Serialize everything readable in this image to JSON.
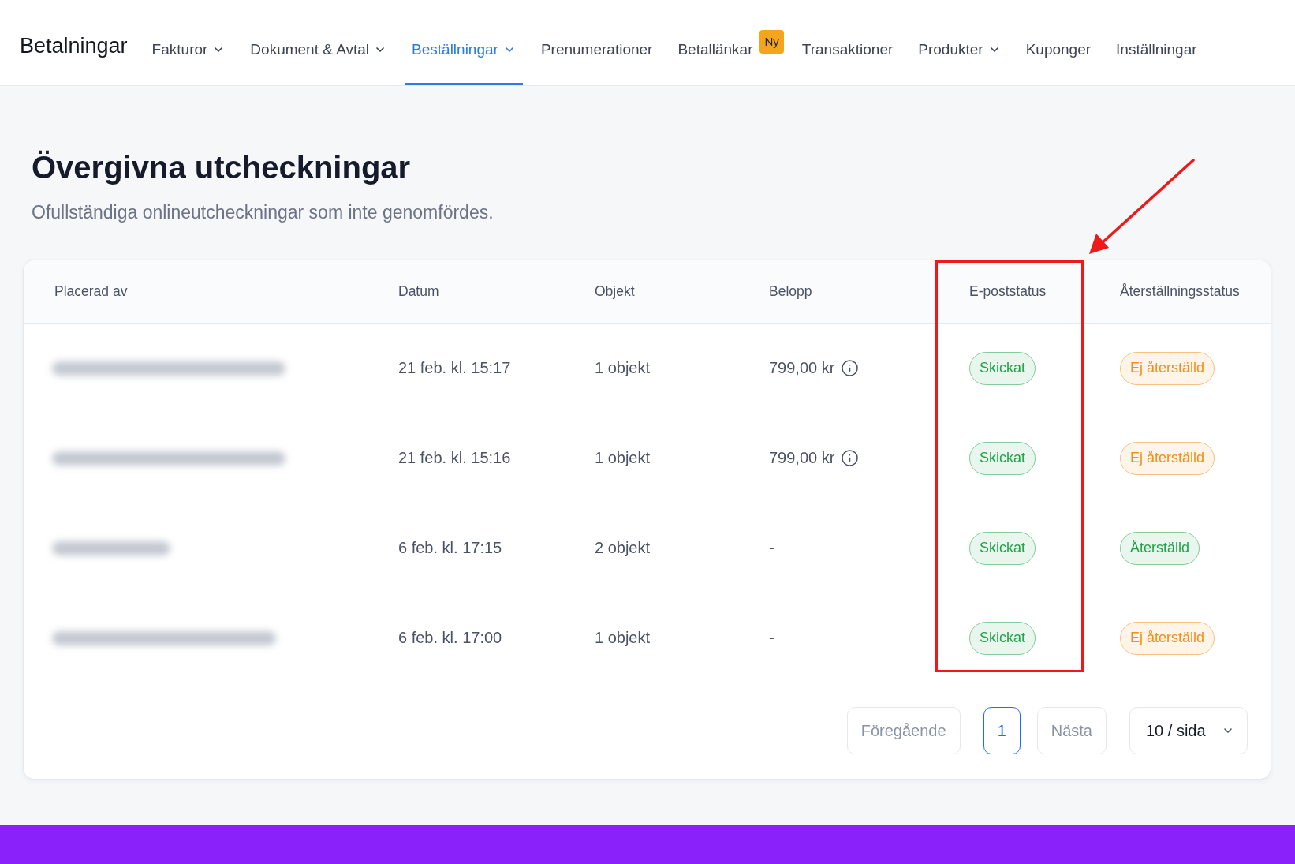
{
  "header": {
    "title": "Betalningar"
  },
  "nav": [
    {
      "label": "Fakturor",
      "selected": false,
      "dropdown": true
    },
    {
      "label": "Dokument & Avtal",
      "selected": false,
      "dropdown": true
    },
    {
      "label": "Beställningar",
      "selected": true,
      "dropdown": true
    },
    {
      "label": "Prenumerationer",
      "selected": false,
      "dropdown": false
    },
    {
      "label": "Betallänkar",
      "selected": false,
      "dropdown": false,
      "badge": "Ny"
    },
    {
      "label": "Transaktioner",
      "selected": false,
      "dropdown": false
    },
    {
      "label": "Produkter",
      "selected": false,
      "dropdown": true
    },
    {
      "label": "Kuponger",
      "selected": false,
      "dropdown": false
    },
    {
      "label": "Inställningar",
      "selected": false,
      "dropdown": false
    }
  ],
  "page": {
    "title": "Övergivna utcheckningar",
    "subtitle": "Ofullständiga onlineutcheckningar som inte genomfördes."
  },
  "table": {
    "columns": [
      "Placerad av",
      "Datum",
      "Objekt",
      "Belopp",
      "E-poststatus",
      "Återställningsstatus"
    ],
    "rows": [
      {
        "date": "21 feb. kl. 15:17",
        "items": "1 objekt",
        "amount": "799,00 kr",
        "amount_info": true,
        "email_status": {
          "label": "Skickat",
          "color": "#22a34a"
        },
        "recovery_status": {
          "label": "Ej återställd",
          "color": "#f0901a"
        }
      },
      {
        "date": "21 feb. kl. 15:16",
        "items": "1 objekt",
        "amount": "799,00 kr",
        "amount_info": true,
        "email_status": {
          "label": "Skickat",
          "color": "#22a34a"
        },
        "recovery_status": {
          "label": "Ej återställd",
          "color": "#f0901a"
        }
      },
      {
        "date": "6 feb. kl. 17:15",
        "items": "2 objekt",
        "amount": "-",
        "amount_info": false,
        "email_status": {
          "label": "Skickat",
          "color": "#22a34a"
        },
        "recovery_status": {
          "label": "Återställd",
          "color": "#22a34a"
        }
      },
      {
        "date": "6 feb. kl. 17:00",
        "items": "1 objekt",
        "amount": "-",
        "amount_info": false,
        "email_status": {
          "label": "Skickat",
          "color": "#22a34a"
        },
        "recovery_status": {
          "label": "Ej återställd",
          "color": "#f0901a"
        }
      }
    ]
  },
  "pagination": {
    "previous": {
      "label": "Föregående",
      "disabled": true
    },
    "pages": [
      {
        "label": "1",
        "selected": true
      }
    ],
    "next": {
      "label": "Nästa",
      "disabled": true
    },
    "page_size": "10 / sida"
  }
}
